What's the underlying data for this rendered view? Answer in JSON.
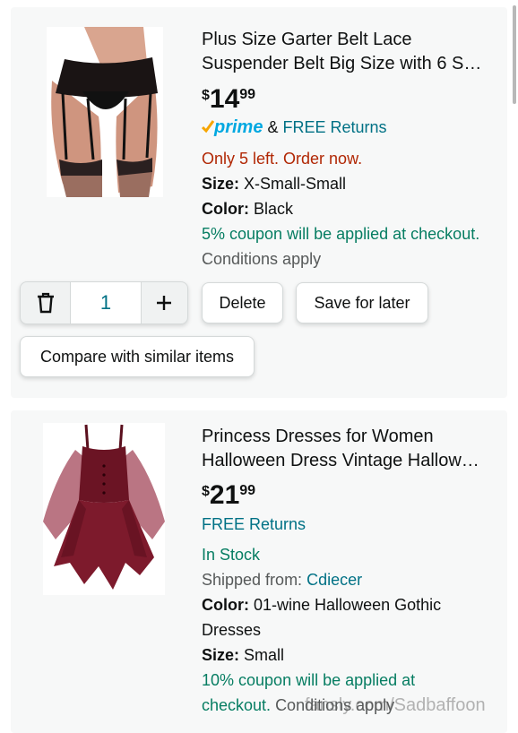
{
  "items": [
    {
      "title_line1": "Plus Size Garter Belt Lace",
      "title_line2": "Suspender Belt Big Size with 6 S…",
      "price_symbol": "$",
      "price_whole": "14",
      "price_fraction": "99",
      "prime_label": "prime",
      "returns_prefix": "&",
      "returns_label": "FREE Returns",
      "stock": "Only 5 left. Order now.",
      "size_label": "Size:",
      "size_value": "X-Small-Small",
      "color_label": "Color:",
      "color_value": "Black",
      "coupon": "5% coupon will be applied at checkout.",
      "conditions": "Conditions apply",
      "quantity": "1",
      "delete_label": "Delete",
      "save_label": "Save for later",
      "compare_label": "Compare with similar items"
    },
    {
      "title_line1": "Princess Dresses for Women",
      "title_line2": "Halloween Dress Vintage Hallow…",
      "price_symbol": "$",
      "price_whole": "21",
      "price_fraction": "99",
      "returns_label": "FREE Returns",
      "stock": "In Stock",
      "shipped_label": "Shipped from:",
      "shipped_value": "Cdiecer",
      "color_label": "Color:",
      "color_value_line1": "01-wine Halloween Gothic",
      "color_value_line2": "Dresses",
      "size_label": "Size:",
      "size_value": "Small",
      "coupon_line1": "10% coupon will be applied at",
      "coupon_line2": "checkout.",
      "conditions": "Conditions apply"
    }
  ],
  "watermark": "fansly.com/Sadbaffoon",
  "icons": {
    "delete": "trash-icon",
    "increase": "plus-icon",
    "prime": "prime-check-icon"
  },
  "colors": {
    "teal": "#007185",
    "green": "#067d62",
    "orange": "#b12704",
    "prime_blue": "#00a8e1",
    "prime_check": "#f7a500"
  }
}
